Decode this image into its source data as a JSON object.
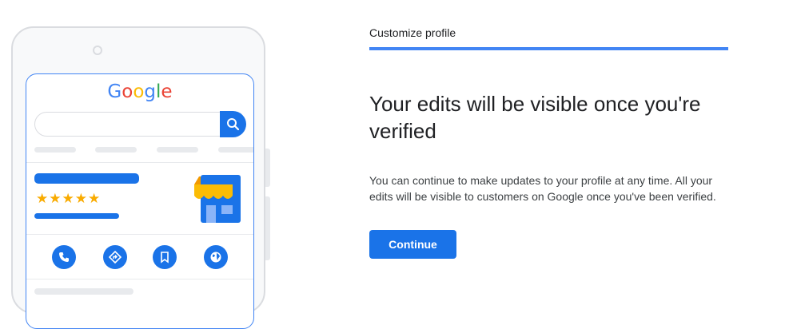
{
  "illustration": {
    "logo_letters": [
      {
        "ch": "G",
        "color": "#4285f4"
      },
      {
        "ch": "o",
        "color": "#ea4335"
      },
      {
        "ch": "o",
        "color": "#fbbc05"
      },
      {
        "ch": "g",
        "color": "#4285f4"
      },
      {
        "ch": "l",
        "color": "#34a853"
      },
      {
        "ch": "e",
        "color": "#ea4335"
      }
    ],
    "stars": "★★★★★",
    "action_icons": [
      "phone-icon",
      "directions-icon",
      "bookmark-icon",
      "globe-icon"
    ]
  },
  "step": {
    "label": "Customize profile"
  },
  "content": {
    "heading": "Your edits will be visible once you're verified",
    "description": "You can continue to make updates to your profile at any time. All your edits will be visible to customers on Google once you've been verified.",
    "continue_label": "Continue"
  },
  "colors": {
    "accent": "#1a73e8",
    "progress": "#4285f4",
    "star": "#f9ab00",
    "awning": "#fbbc05"
  }
}
